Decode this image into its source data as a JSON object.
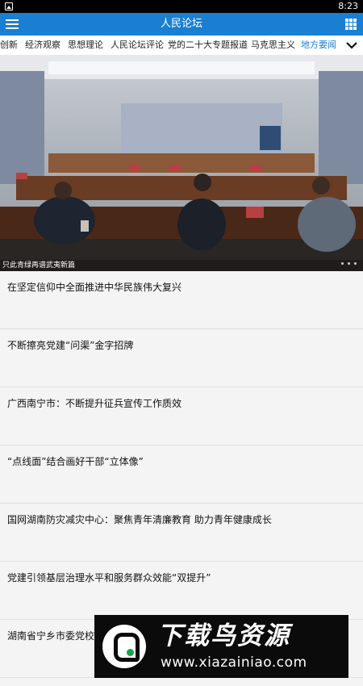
{
  "status_bar": {
    "time": "8:23"
  },
  "app_bar": {
    "title": "人民论坛",
    "menu_icon": "menu-icon",
    "grid_icon": "grid-icon",
    "accent_color": "#1a7fd1"
  },
  "tabs": {
    "items": [
      {
        "label": "创新"
      },
      {
        "label": "经济观察"
      },
      {
        "label": "思想理论"
      },
      {
        "label": "人民论坛评论"
      },
      {
        "label": "党的二十大专题报道"
      },
      {
        "label": "马克思主义"
      },
      {
        "label": "地方要闻",
        "active": true
      }
    ],
    "more_icon": "chevron-down-icon"
  },
  "banner": {
    "caption": "只此青绿再谱武夷新篇",
    "slide_count": 3
  },
  "news": [
    {
      "headline": "在坚定信仰中全面推进中华民族伟大复兴"
    },
    {
      "headline": "不断擦亮党建“问渠”金字招牌"
    },
    {
      "headline": "广西南宁市：不断提升征兵宣传工作质效"
    },
    {
      "headline": "“点线面”结合画好干部“立体像”"
    },
    {
      "headline": "国网湖南防灾减灾中心：聚焦青年清廉教育 助力青年健康成长"
    },
    {
      "headline": "党建引领基层治理水平和服务群众效能“双提升”"
    },
    {
      "headline": "湖南省宁乡市委党校推"
    }
  ],
  "watermark": {
    "title": "下载鸟资源",
    "url": "www.xiazainiao.com"
  }
}
